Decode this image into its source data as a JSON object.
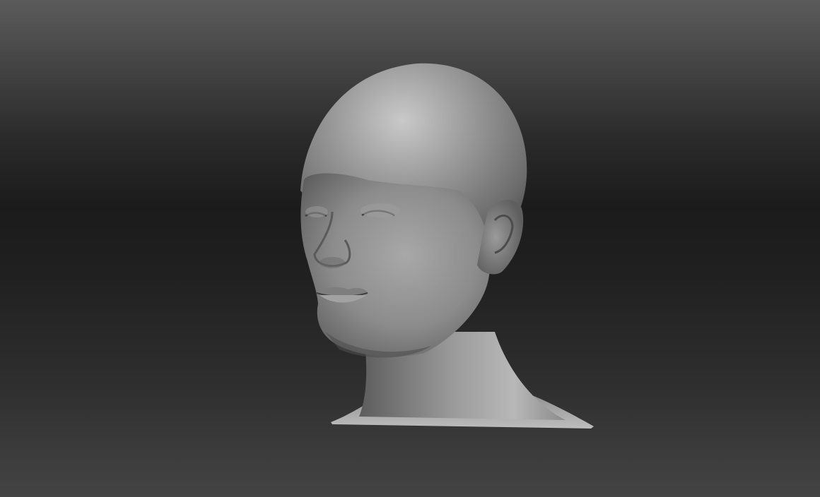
{
  "viewport": {
    "background_top": "#5b5b5b",
    "background_mid": "#1b1b1b",
    "background_bottom": "#444444"
  },
  "model": {
    "kind": "sculpted-head-bust",
    "material_color": "#8f8f8f",
    "highlight_color": "#c4c4c4",
    "shadow_color": "#3a3a3a",
    "eyes": "closed"
  }
}
